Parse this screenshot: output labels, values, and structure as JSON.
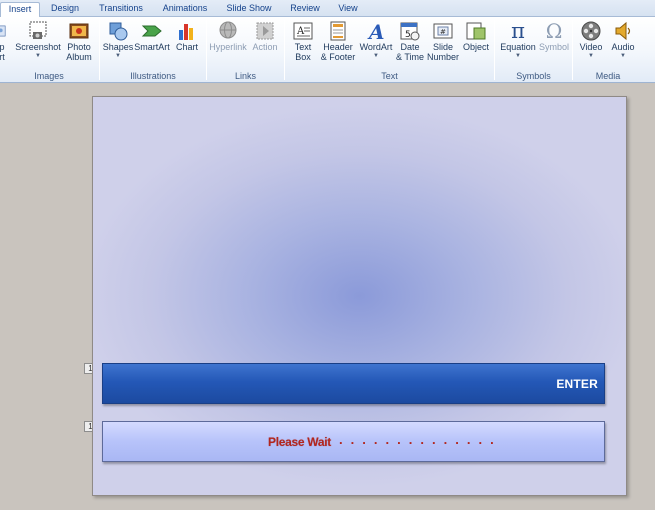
{
  "tabs": [
    {
      "label": "Insert",
      "active": true
    },
    {
      "label": "Design"
    },
    {
      "label": "Transitions"
    },
    {
      "label": "Animations"
    },
    {
      "label": "Slide Show"
    },
    {
      "label": "Review"
    },
    {
      "label": "View"
    }
  ],
  "ribbon": {
    "groups": {
      "images": "Images",
      "illustrations": "Illustrations",
      "links": "Links",
      "text": "Text",
      "symbols": "Symbols",
      "media": "Media"
    },
    "buttons": {
      "clipart": {
        "line1": "p",
        "line2": "rt",
        "icon": "clipart-icon"
      },
      "screenshot": {
        "line1": "Screenshot",
        "icon": "screenshot-icon"
      },
      "photo_album": {
        "line1": "Photo",
        "line2": "Album",
        "icon": "photo-album-icon"
      },
      "shapes": {
        "line1": "Shapes",
        "icon": "shapes-icon"
      },
      "smartart": {
        "line1": "SmartArt",
        "icon": "smartart-icon"
      },
      "chart": {
        "line1": "Chart",
        "icon": "chart-icon"
      },
      "hyperlink": {
        "line1": "Hyperlink",
        "icon": "hyperlink-icon"
      },
      "action": {
        "line1": "Action",
        "icon": "action-icon"
      },
      "text_box": {
        "line1": "Text",
        "line2": "Box",
        "icon": "text-box-icon"
      },
      "header_footer": {
        "line1": "Header",
        "line2": "& Footer",
        "icon": "header-footer-icon"
      },
      "wordart": {
        "line1": "WordArt",
        "icon": "wordart-icon"
      },
      "date_time": {
        "line1": "Date",
        "line2": "& Time",
        "icon": "date-time-icon"
      },
      "slide_number": {
        "line1": "Slide",
        "line2": "Number",
        "icon": "slide-number-icon"
      },
      "object": {
        "line1": "Object",
        "icon": "object-icon"
      },
      "equation": {
        "line1": "Equation",
        "icon": "pi-icon",
        "glyph": "π"
      },
      "symbol": {
        "line1": "Symbol",
        "icon": "omega-icon",
        "glyph": "Ω"
      },
      "video": {
        "line1": "Video",
        "icon": "film-reel-icon"
      },
      "audio": {
        "line1": "Audio",
        "icon": "speaker-icon"
      }
    }
  },
  "slide": {
    "marker_enter": "1",
    "marker_wait": "1",
    "enter_label": "ENTER",
    "wait_label": "Please Wait",
    "wait_dots": ". . . . . . . . . . . . . .",
    "colors": {
      "enter_bar": "#2458b7",
      "wait_bar": "#b7c3fa",
      "wait_text": "#b3261e",
      "slide_center": "#8b9ad9"
    }
  }
}
